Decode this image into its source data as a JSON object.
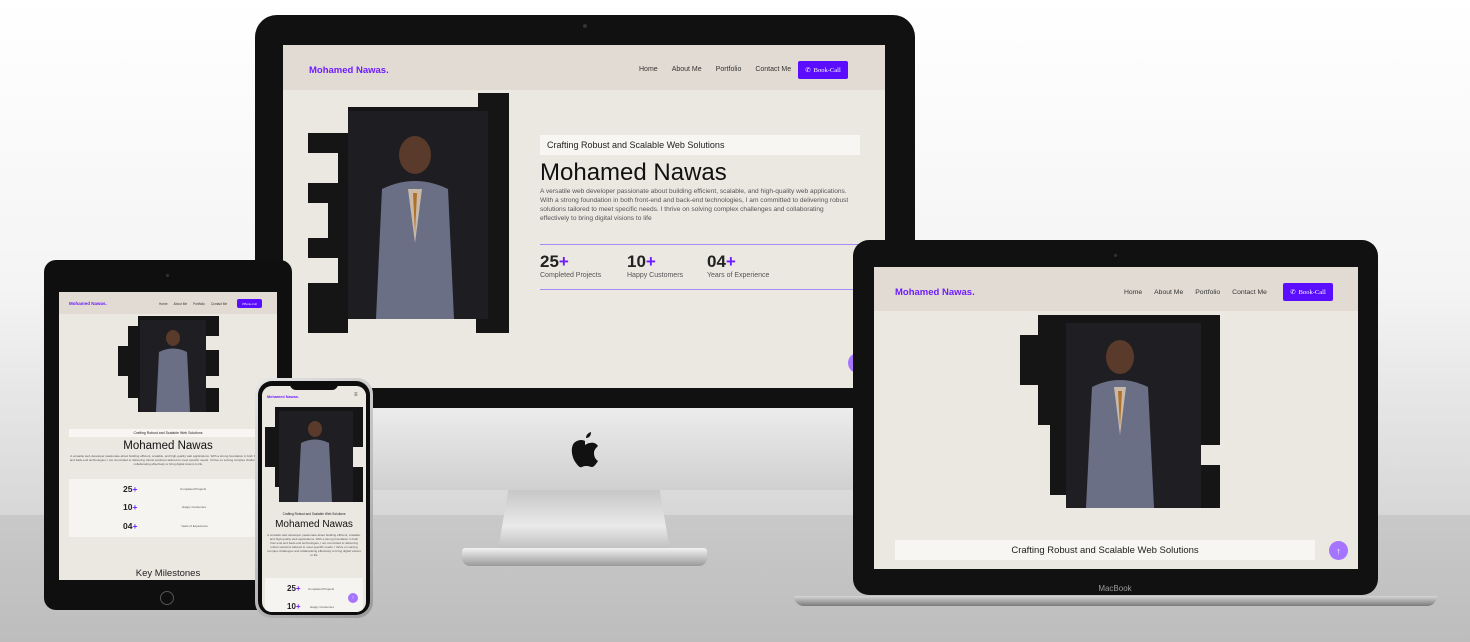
{
  "site": {
    "brand": "Mohamed Nawas.",
    "nav": [
      "Home",
      "About Me",
      "Portfolio",
      "Contact Me"
    ],
    "cta_label": "Book-Call",
    "tagline": "Crafting Robust and Scalable Web Solutions",
    "name": "Mohamed Nawas",
    "bio": "A versatile web developer passionate about building efficient, scalable, and high-quality web applications. With a strong foundation in both front-end and back-end technologies, I am committed to delivering robust solutions tailored to meet specific needs. I thrive on solving complex challenges and collaborating effectively to bring digital visions to life",
    "stats": [
      {
        "num": "25",
        "plus": "+",
        "label": "Completed Projects"
      },
      {
        "num": "10",
        "plus": "+",
        "label": "Happy Customers"
      },
      {
        "num": "04",
        "plus": "+",
        "label": "Years of Experience"
      }
    ],
    "milestones_heading": "Key Milestones"
  },
  "devices": {
    "laptop_label": "MacBook"
  },
  "colors": {
    "accent": "#5b0dff",
    "brand": "#6f1bff",
    "background": "#ebe8e2",
    "nav_bg": "#e2dbd3"
  },
  "icons": [
    "phone-icon",
    "arrow-up-icon",
    "hamburger-menu-icon",
    "apple-logo-icon"
  ]
}
